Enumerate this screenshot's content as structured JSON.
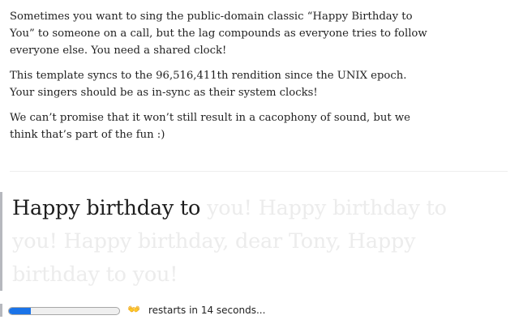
{
  "intro": {
    "paragraphs": [
      "Sometimes you want to sing the public-domain classic “Happy Birthday to You” to someone on a call, but the lag compounds as everyone tries to follow everyone else. You need a shared clock!",
      "This template syncs to the 96,516,411th rendition since the UNIX epoch. Your singers should be as in-sync as their system clocks!",
      "We can’t promise that it won’t still result in a cacophony of sound, but we think that’s part of the fun :)"
    ]
  },
  "lyrics": {
    "sung": "Happy birthday to",
    "unsung": " you! Happy birthday to you! Happy birthday, dear Tony, Happy birthday to you!"
  },
  "status": {
    "progress_fraction": 0.2,
    "icon": "clapping-hands-icon",
    "icon_glyph": "👐",
    "restart_text": "restarts in 14 seconds..."
  },
  "colors": {
    "progress_fill": "#1a73e8",
    "lyrics_sung": "#1d1d1d",
    "lyrics_unsung": "#ececec",
    "accent_rule": "#b6b8be"
  }
}
